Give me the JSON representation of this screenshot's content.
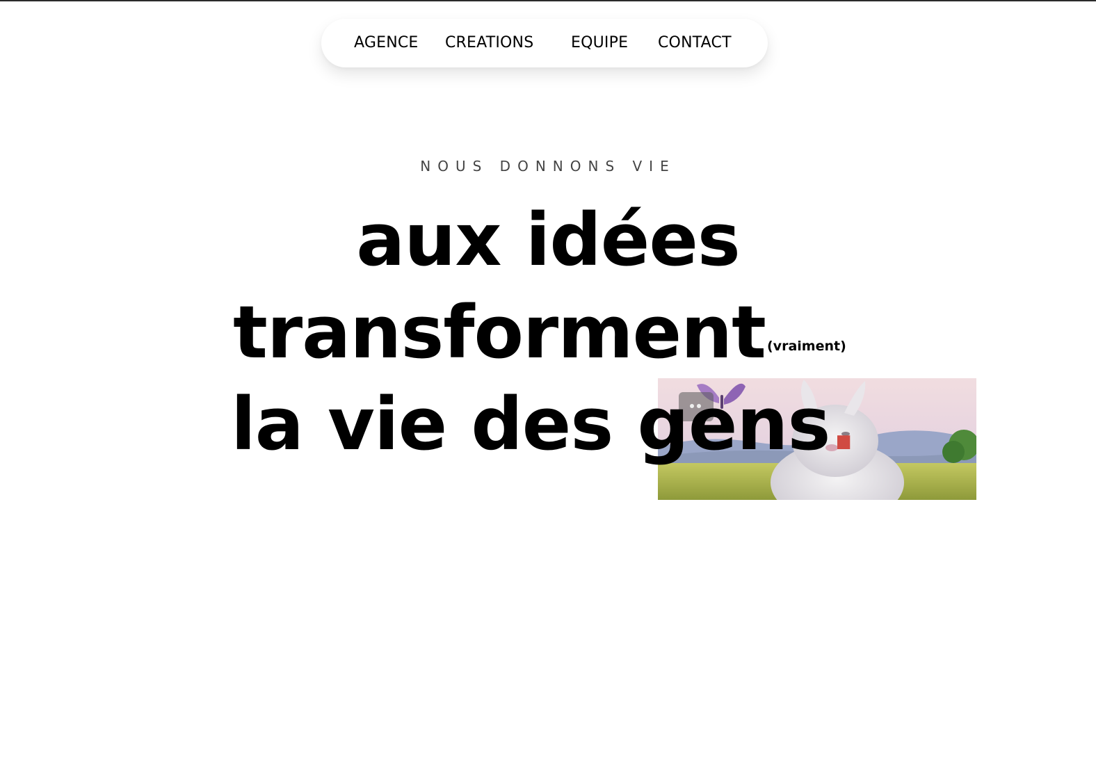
{
  "nav": {
    "items": [
      {
        "label": "AGENCE"
      },
      {
        "label": "CREATIONS"
      },
      {
        "label": "EQUIPE"
      },
      {
        "label": "CONTACT"
      }
    ]
  },
  "hero": {
    "eyebrow": "NOUS DONNONS VIE",
    "line1": "aux idées",
    "line2": "transforment",
    "aside": "(vraiment)",
    "line3": "la vie des gens",
    "accent_dot": ".",
    "accent_color": "#d04a42"
  },
  "video": {
    "icon": "play-badge-icon"
  }
}
